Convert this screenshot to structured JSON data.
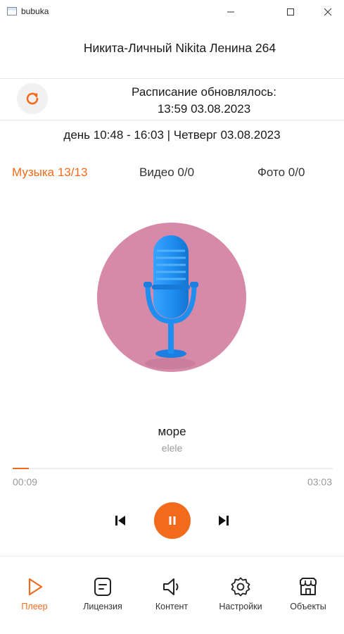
{
  "window": {
    "title": "bubuka"
  },
  "header": {
    "org_name": "Никита-Личный Nikita Ленина 264",
    "schedule_label": "Расписание обновлялось:",
    "schedule_time": "13:59 03.08.2023",
    "day_info": "день 10:48 - 16:03 | Четверг 03.08.2023"
  },
  "tabs": [
    {
      "label": "Музыка 13/13",
      "active": true
    },
    {
      "label": "Видео 0/0",
      "active": false
    },
    {
      "label": "Фото 0/0",
      "active": false
    }
  ],
  "player": {
    "artwork_icon": "microphone-icon",
    "track_title": "море",
    "track_artist": "elele",
    "current_time": "00:09",
    "total_time": "03:03",
    "progress": 0.05,
    "state": "playing"
  },
  "nav": {
    "items": [
      {
        "label": "Плеер",
        "icon": "play-outline-icon",
        "active": true
      },
      {
        "label": "Лицензия",
        "icon": "license-icon",
        "active": false
      },
      {
        "label": "Контент",
        "icon": "speaker-icon",
        "active": false
      },
      {
        "label": "Настройки",
        "icon": "gear-icon",
        "active": false
      },
      {
        "label": "Объекты",
        "icon": "store-icon",
        "active": false
      }
    ]
  },
  "colors": {
    "accent": "#f26a1b",
    "artwork_bg": "#d68aa8",
    "mic": "#1e8ef0"
  }
}
